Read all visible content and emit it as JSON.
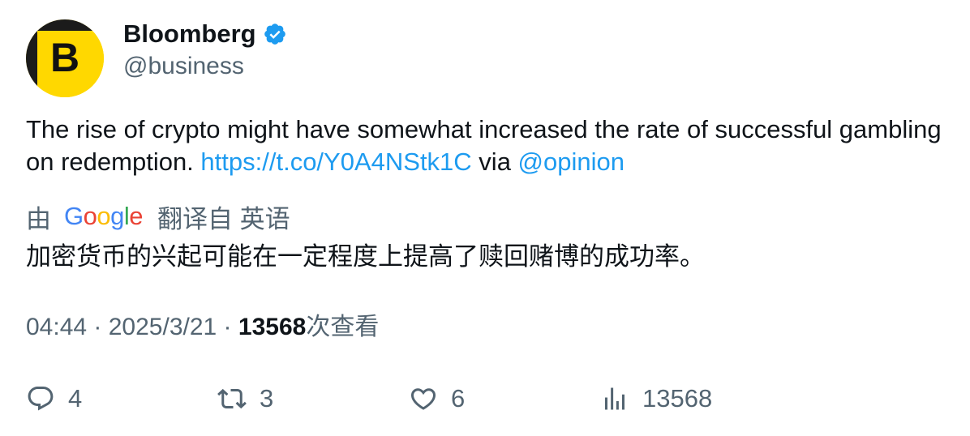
{
  "author": {
    "avatar_letter": "B",
    "display_name": "Bloomberg",
    "handle": "@business",
    "verified": true,
    "avatar_color": "#ffd800",
    "verified_color": "#1d9bf0"
  },
  "tweet": {
    "text_before_link": "The rise of crypto might have somewhat increased the rate of successful gambling on redemption. ",
    "link": "https://t.co/Y0A4NStk1C",
    "text_via": " via ",
    "mention": "@opinion"
  },
  "translation": {
    "prefix": "由",
    "provider_logo_text": "Google",
    "suffix": "翻译自 英语",
    "text": "加密货币的兴起可能在一定程度上提高了赎回赌博的成功率。"
  },
  "meta": {
    "time": "04:44",
    "separator1": " · ",
    "date": "2025/3/21",
    "separator2": " · ",
    "views_count": "13568",
    "views_label": "次查看"
  },
  "actions": {
    "replies": "4",
    "retweets": "3",
    "likes": "6",
    "views": "13568"
  },
  "colors": {
    "link": "#1d9bf0",
    "secondary_text": "#536471",
    "primary_text": "#0f1419"
  }
}
